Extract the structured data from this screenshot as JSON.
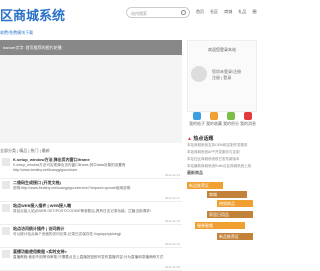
{
  "header": {
    "logo": "区商城系统",
    "search_placeholder": "站内搜索",
    "nav": [
      "首页",
      "社区",
      "商城",
      "礼品",
      "圈子"
    ]
  },
  "subbar": "收费/免费模块下载",
  "banner": "banner文字: 首页推荐的图片轮播",
  "sidebar": {
    "title": "欢迎您登录本站",
    "info_line1": "您尚未登录/注册",
    "info_line2": "注册 | 登录",
    "quick_links": [
      "我的帖子",
      "我的收藏",
      "我的积分",
      "我的消息"
    ],
    "hot_title": "热点话题",
    "hot_items": [
      "本站商城系统支持OEM和定制开发服务",
      "本站商城系统APP开发服务与定制",
      "本站社区商城系统现已发布新版本",
      "本站最新商城系统Ruffs社区商城系统上线"
    ],
    "latest_title": "最新商品",
    "tree_nodes": [
      "新品推荐区",
      "商城",
      "热销商品",
      "家居日用品",
      "服装鞋帽",
      "新品推荐区"
    ]
  },
  "section_label": "全部分类 | 精品 | 热门 | 最新",
  "articles": [
    {
      "title": "K.setup_window方法,弹出页内窗口iframe",
      "desc": "K.setup_window方法可实现弹出页内窗口iframe,其中data对象的设置有http://www.bedshy.net/kuangyigou/share",
      "time": "2022-11-14"
    },
    {
      "title": "二维码生成接口 (开发文档)",
      "desc": "说明:http://www.bedshy.net/kuangyigou/service/?request=qrcode使用说明",
      "time": "2022-11-17"
    },
    {
      "title": "站点WEB接入插件 | WEB接入端",
      "desc": "将站点接入站点WEB GET/POST/COOKIE等参数后,具有日志记录功能。拦截当前请求!",
      "time": "2022-11-13"
    },
    {
      "title": "站点访问统计插件 | 访问统计",
      "desc": "可以统计站点每个页面的访问记录,记录日志保存在:/log/app/pjctongji",
      "time": "2022-11-10"
    },
    {
      "title": "直播功能使用教程 <实时支持>",
      "desc": "直播教程:使用不用等待审核,只需要点击上直播按钮即可发布直播内容,分为直播和录播两种方式",
      "time": "2022-11-09"
    }
  ],
  "colors": {
    "accent": "#2a72c8",
    "tree_orange": "#f0a030",
    "tree_brown": "#c2823a"
  }
}
